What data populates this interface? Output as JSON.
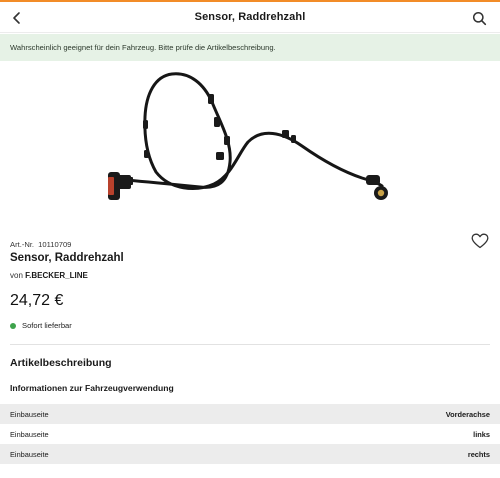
{
  "colors": {
    "accent": "#f28c28",
    "notice_bg": "#e6f2e6",
    "available": "#3ea34b"
  },
  "header": {
    "title": "Sensor, Raddrehzahl",
    "back_icon": "chevron-left-icon",
    "search_icon": "search-icon"
  },
  "notice": {
    "text": "Wahrscheinlich geeignet für dein Fahrzeug. Bitte prüfe die Artikelbeschreibung."
  },
  "product": {
    "art_label": "Art.-Nr.",
    "art_number": "10110709",
    "name": "Sensor, Raddrehzahl",
    "brand_prefix": "von",
    "brand": "F.BECKER_LINE",
    "price": "24,72 €",
    "availability": "Sofort lieferbar",
    "wishlist_icon": "heart-icon"
  },
  "description": {
    "title": "Artikelbeschreibung",
    "vehicle_info_title": "Informationen zur Fahrzeugverwendung",
    "rows": [
      {
        "label": "Einbauseite",
        "value": "Vorderachse"
      },
      {
        "label": "Einbauseite",
        "value": "links"
      },
      {
        "label": "Einbauseite",
        "value": "rechts"
      }
    ]
  }
}
